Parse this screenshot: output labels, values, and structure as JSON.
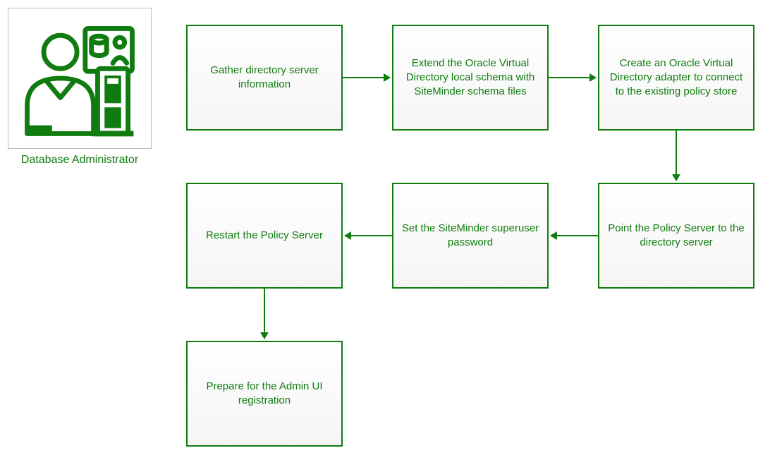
{
  "actor": {
    "label": "Database Administrator"
  },
  "steps": {
    "s1": "Gather directory server information",
    "s2": "Extend the Oracle Virtual Directory local schema with SiteMinder schema files",
    "s3": "Create an Oracle Virtual Directory adapter to connect to the existing policy store",
    "s4": "Point the Policy Server to the directory server",
    "s5": "Set the SiteMinder superuser password",
    "s6": "Restart the Policy Server",
    "s7": "Prepare for the Admin UI registration"
  },
  "colors": {
    "primary": "#107c10",
    "border_light": "#bfbfbf"
  }
}
